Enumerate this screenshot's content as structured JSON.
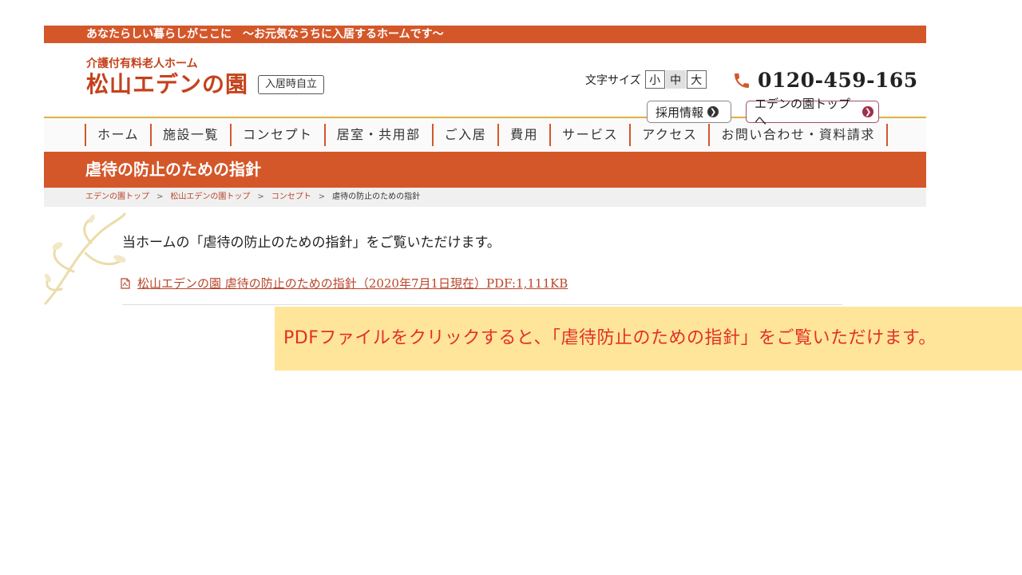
{
  "site": {
    "tagline": "あなたらしい暮らしがここに　～お元気なうちに入居するホームです～",
    "logo_sub": "介護付有料老人ホーム",
    "logo_main": "松山エデンの園",
    "logo_badge": "入居時自立",
    "font_size_label": "文字サイズ",
    "font_sizes": [
      "小",
      "中",
      "大"
    ],
    "phone": "0120-459-165",
    "recruit_label": "採用情報",
    "eden_top_label": "エデンの園トップへ"
  },
  "nav": {
    "items": [
      {
        "label": "ホーム"
      },
      {
        "label": "施設一覧"
      },
      {
        "label": "コンセプト"
      },
      {
        "label": "居室・共用部"
      },
      {
        "label": "ご入居"
      },
      {
        "label": "費用"
      },
      {
        "label": "サービス"
      },
      {
        "label": "アクセス"
      },
      {
        "label": "お問い合わせ・資料請求"
      }
    ]
  },
  "page": {
    "title": "虐待の防止のための指針",
    "breadcrumb": [
      "エデンの園トップ",
      "松山エデンの園トップ",
      "コンセプト",
      "虐待の防止のための指針"
    ],
    "breadcrumb_sep": ">",
    "intro": "当ホームの「虐待の防止のための指針」をご覧いただけます。",
    "pdf_link": "松山エデンの園 虐待の防止のための指針（2020年7月1日現在）PDF:1,111KB"
  },
  "callout": {
    "text": "PDFファイルをクリックすると、「虐待防止のための指針」をご覧いただけます。"
  },
  "colors": {
    "accent": "#d4572a",
    "nav_border_top": "#e0b240",
    "callout_bg": "#ffe599",
    "callout_text": "#e0302a"
  }
}
